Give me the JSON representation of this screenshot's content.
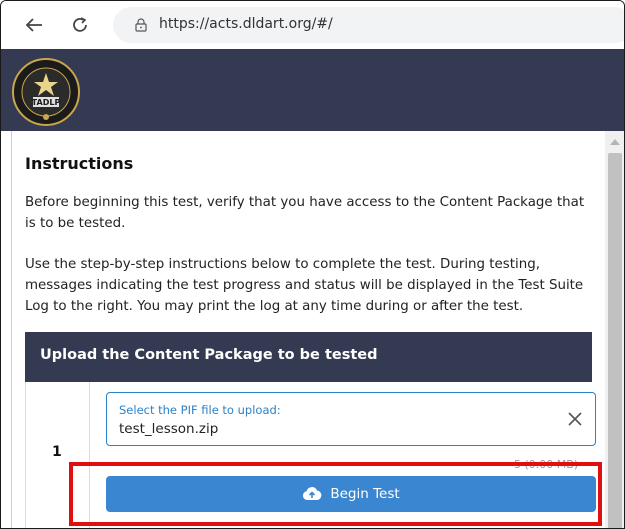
{
  "browser": {
    "url": "https://acts.dldart.org/#/",
    "back_icon": "arrow-left",
    "reload_icon": "reload"
  },
  "site": {
    "logo_text": "TADLP"
  },
  "instructions": {
    "heading": "Instructions",
    "para1": "Before beginning this test, verify that you have access to the Content Package that is to be tested.",
    "para2": "Use the step-by-step instructions below to complete the test. During testing, messages indicating the test progress and status will be displayed in the Test Suite Log to the right. You may print the log at any time during or after the test."
  },
  "upload": {
    "header": "Upload the Content Package to be tested",
    "step_number": "1",
    "file_label": "Select the PIF file to upload:",
    "file_value": "test_lesson.zip",
    "file_size": "5 (0.00 MB)",
    "begin_label": "Begin Test"
  },
  "colors": {
    "header_bg": "#343a52",
    "accent_blue": "#3b86d1",
    "highlight_red": "#e01010"
  }
}
